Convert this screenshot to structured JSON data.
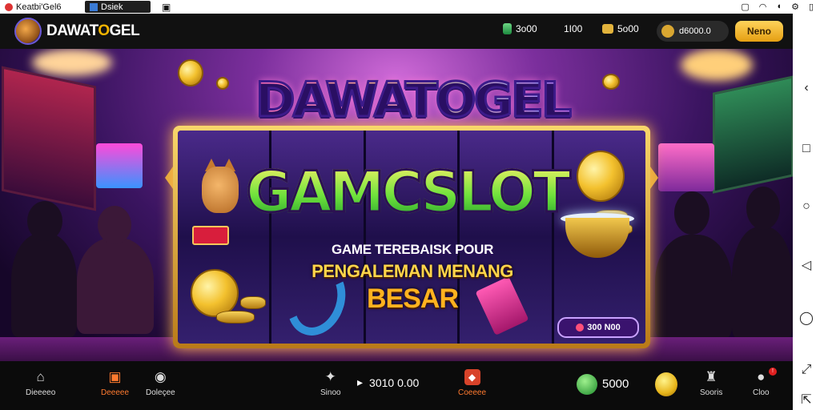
{
  "statusbar": {
    "tab1_label": "Keatbi'Gel6",
    "tab2_label": "Dsiek",
    "icons": [
      "wifi-icon",
      "volume-icon",
      "settings-icon",
      "phone-icon"
    ]
  },
  "header": {
    "logo_text_pre": "DAWAT",
    "logo_text_o": "O",
    "logo_text_post": "GEL",
    "stat1": "3o00",
    "stat2": "1I00",
    "stat3": "5o00",
    "wallet_value": "d6000.0",
    "primary_button": "Neno"
  },
  "banner": {
    "title": "DAWATOGEL",
    "main": "GAMCSLOT",
    "sub1": "GAME TEREBAISK POUR",
    "sub2": "PENGALEMAN MENANG",
    "sub3": "BESAR",
    "prize": "300 N00"
  },
  "footer": {
    "items": [
      {
        "label": "Dieeeeo"
      },
      {
        "label": "Deeeee"
      },
      {
        "label": "Doleçee"
      },
      {
        "label": "Sinoo"
      },
      {
        "label": "Coeeee"
      },
      {
        "label": "Sooris"
      },
      {
        "label": "Cloo"
      }
    ],
    "balance": "3010 0.00",
    "gem_value": "5000",
    "accent": "#ff7a2f"
  }
}
